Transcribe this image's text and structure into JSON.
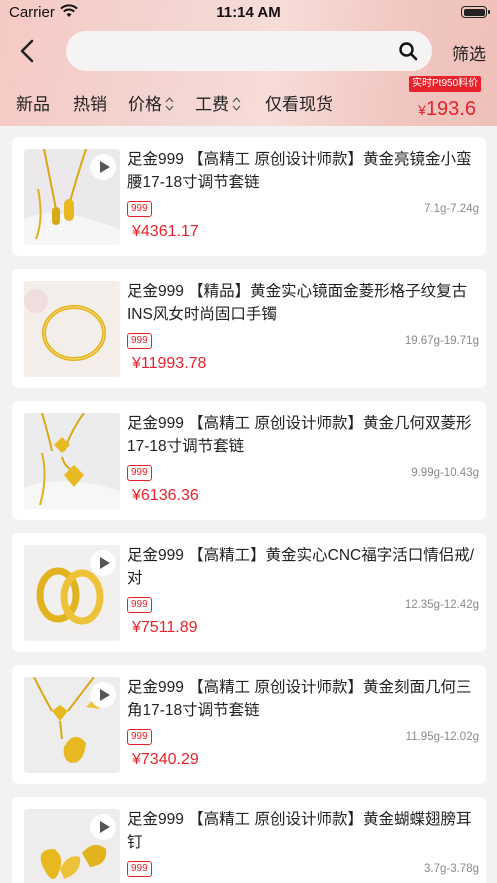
{
  "status_bar": {
    "carrier": "Carrier",
    "time": "11:14 AM"
  },
  "search": {
    "placeholder": ""
  },
  "header": {
    "filter_label": "筛选"
  },
  "nav": {
    "items": [
      {
        "label": "新品"
      },
      {
        "label": "热销"
      },
      {
        "label": "价格"
      },
      {
        "label": "工费"
      },
      {
        "label": "仅看现货"
      }
    ]
  },
  "live_price": {
    "tag": "实时Pt950料价",
    "currency": "¥",
    "value": "193.6"
  },
  "products": [
    {
      "title": "足金999 【高精工 原创设计师款】黄金亮镜金小蛮腰17-18寸调节套链",
      "badge": "999",
      "weight": "7.1g-7.24g",
      "price": "¥4361.17",
      "kind": "necklace-a"
    },
    {
      "title": "足金999 【精品】黄金实心镜面金菱形格子纹复古INS风女时尚固口手镯",
      "badge": "999",
      "weight": "19.67g-19.71g",
      "price": "¥11993.78",
      "kind": "bangle"
    },
    {
      "title": "足金999 【高精工 原创设计师款】黄金几何双菱形17-18寸调节套链",
      "badge": "999",
      "weight": "9.99g-10.43g",
      "price": "¥6136.36",
      "kind": "necklace-b"
    },
    {
      "title": "足金999 【高精工】黄金实心CNC福字活口情侣戒/对",
      "badge": "999",
      "weight": "12.35g-12.42g",
      "price": "¥7511.89",
      "kind": "rings"
    },
    {
      "title": "足金999 【高精工 原创设计师款】黄金刻面几何三角17-18寸调节套链",
      "badge": "999",
      "weight": "11.95g-12.02g",
      "price": "¥7340.29",
      "kind": "necklace-c"
    },
    {
      "title": "足金999 【高精工 原创设计师款】黄金蝴蝶翅膀耳钉",
      "badge": "999",
      "weight": "3.7g-3.78g",
      "price": "",
      "kind": "earrings"
    }
  ]
}
